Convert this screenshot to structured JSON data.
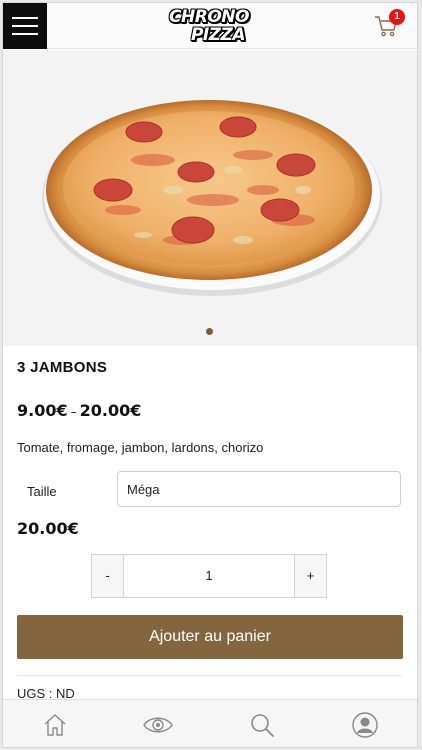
{
  "header": {
    "logo_line1": "CHRONO",
    "logo_line2": "PIZZA",
    "cart_count": "1"
  },
  "product": {
    "image": "pizza-photo",
    "slide_count": 1,
    "title": "3 JAMBONS",
    "price_min": "9.00€",
    "price_sep": "–",
    "price_max": "20.00€",
    "description": "Tomate, fromage, jambon, lardons, chorizo",
    "size_label": "Taille",
    "size_value": "Méga",
    "selected_price": "20.00€",
    "qty_minus": "-",
    "qty_value": "1",
    "qty_plus": "+",
    "add_to_cart": "Ajouter au panier",
    "sku_label": "UGS :",
    "sku_value": "ND"
  },
  "bottom_nav": [
    "home-icon",
    "eye-icon",
    "search-icon",
    "account-icon"
  ],
  "colors": {
    "accent": "#84663e",
    "badge": "#e11111",
    "menu_bg": "#0d0d0d"
  }
}
